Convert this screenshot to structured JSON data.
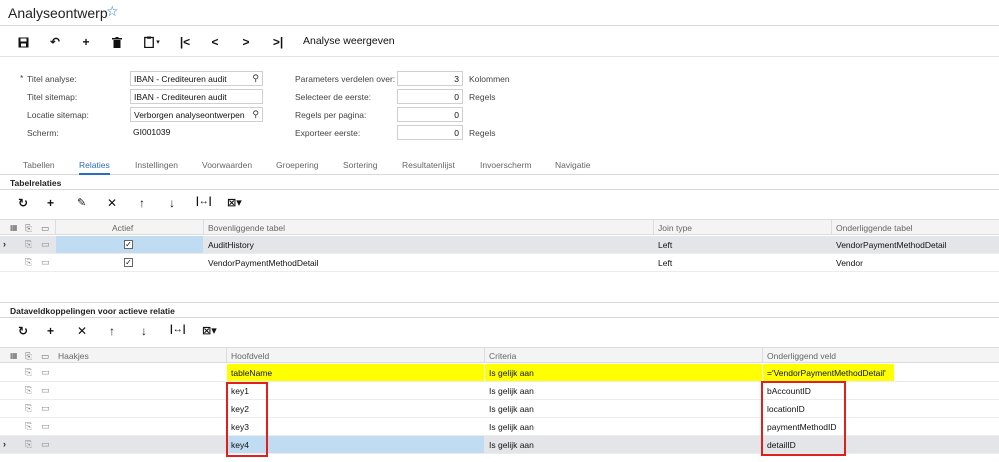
{
  "page": {
    "title": "Analyseontwerp"
  },
  "toolbar": {
    "action_label": "Analyse weergeven"
  },
  "form": {
    "left": [
      {
        "label": "Titel analyse:",
        "value": "IBAN - Crediteuren audit",
        "required": true,
        "lookup": true
      },
      {
        "label": "Titel sitemap:",
        "value": "IBAN - Crediteuren audit",
        "required": false,
        "lookup": false
      },
      {
        "label": "Locatie sitemap:",
        "value": "Verborgen analyseontwerpen",
        "required": false,
        "lookup": true
      },
      {
        "label": "Scherm:",
        "value": "GI001039",
        "required": false,
        "lookup": false
      }
    ],
    "right": [
      {
        "label": "Parameters verdelen over:",
        "value": "3",
        "unit": "Kolommen"
      },
      {
        "label": "Selecteer de eerste:",
        "value": "0",
        "unit": "Regels"
      },
      {
        "label": "Regels per pagina:",
        "value": "0",
        "unit": ""
      },
      {
        "label": "Exporteer eerste:",
        "value": "0",
        "unit": "Regels"
      }
    ],
    "required_mark": "*"
  },
  "tabs": [
    "Tabellen",
    "Relaties",
    "Instellingen",
    "Voorwaarden",
    "Groepering",
    "Sortering",
    "Resultatenlijst",
    "Invoerscherm",
    "Navigatie"
  ],
  "active_tab": "Relaties",
  "relations": {
    "title": "Tabelrelaties",
    "headers": {
      "active": "Actief",
      "parent": "Bovenliggende tabel",
      "join": "Join type",
      "child": "Onderliggende tabel"
    },
    "rows": [
      {
        "active": true,
        "parent": "AuditHistory",
        "join": "Left",
        "child": "VendorPaymentMethodDetail",
        "selected": true
      },
      {
        "active": true,
        "parent": "VendorPaymentMethodDetail",
        "join": "Left",
        "child": "Vendor",
        "selected": false
      }
    ]
  },
  "links": {
    "title": "Dataveldkoppelingen voor actieve relatie",
    "headers": {
      "brackets": "Haakjes",
      "main": "Hoofdveld",
      "criteria": "Criteria",
      "sub": "Onderliggend veld"
    },
    "rows": [
      {
        "main": "tableName",
        "criteria": "Is gelijk aan",
        "sub": "='VendorPaymentMethodDetail'",
        "highlight": true,
        "selected": false
      },
      {
        "main": "key1",
        "criteria": "Is gelijk aan",
        "sub": "bAccountID",
        "highlight": false,
        "selected": false
      },
      {
        "main": "key2",
        "criteria": "Is gelijk aan",
        "sub": "locationID",
        "highlight": false,
        "selected": false
      },
      {
        "main": "key3",
        "criteria": "Is gelijk aan",
        "sub": "paymentMethodID",
        "highlight": false,
        "selected": false
      },
      {
        "main": "key4",
        "criteria": "Is gelijk aan",
        "sub": "detailID",
        "highlight": false,
        "selected": true
      }
    ]
  },
  "icons": {
    "star": "star-icon",
    "save": "save-icon",
    "undo": "undo-icon",
    "add": "plus-icon",
    "delete": "trash-icon",
    "copy": "clipboard-icon",
    "first": "first-icon",
    "prev": "prev-icon",
    "next": "next-icon",
    "last": "last-icon"
  },
  "colors": {
    "accent": "#2a6fbb",
    "selection": "#bfdcf2",
    "highlight": "#ffff00",
    "annotation": "#e0201c"
  }
}
